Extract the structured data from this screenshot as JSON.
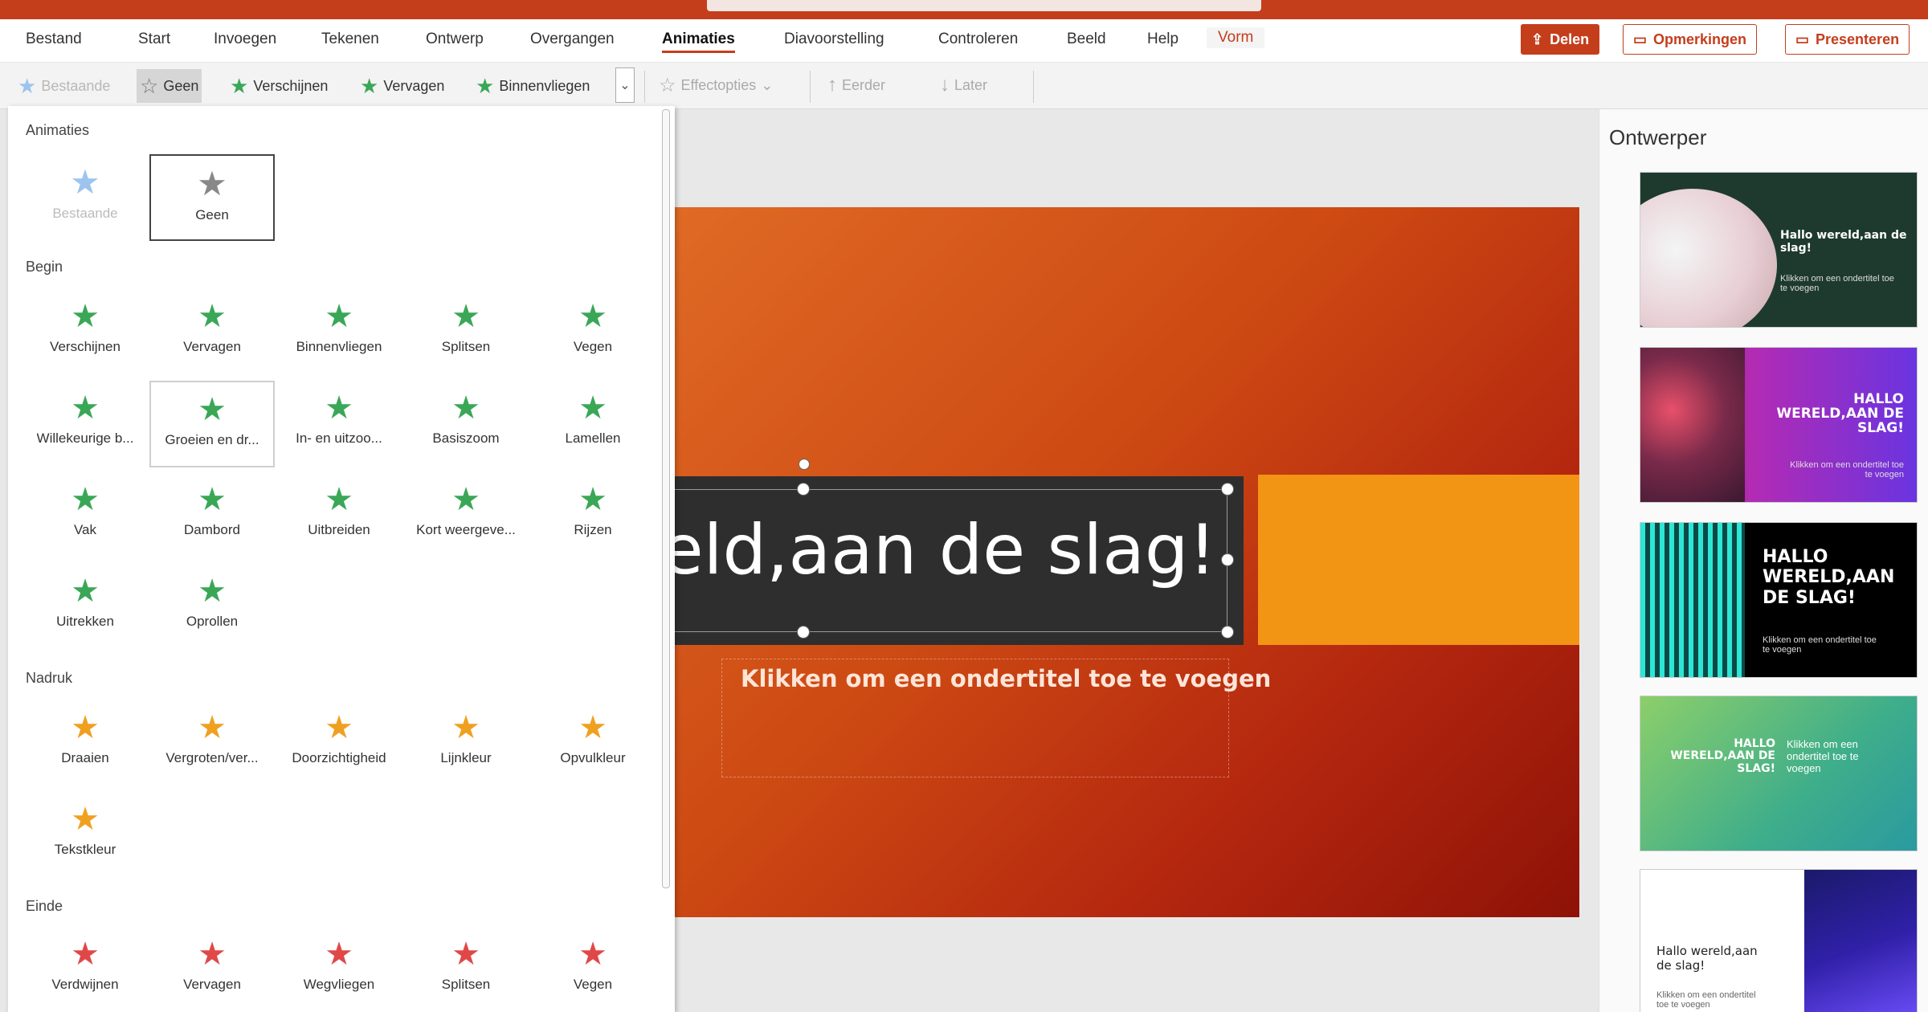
{
  "menu": [
    "Bestand",
    "Start",
    "Invoegen",
    "Tekenen",
    "Ontwerp",
    "Overgangen",
    "Animaties",
    "Diavoorstelling",
    "Controleren",
    "Beeld",
    "Help",
    "Vorm"
  ],
  "header": {
    "share": "Delen",
    "comments": "Opmerkingen",
    "present": "Presenteren"
  },
  "ribbon": {
    "gallery": [
      {
        "label": "Bestaande",
        "state": "disabled"
      },
      {
        "label": "Geen",
        "state": "selected"
      },
      {
        "label": "Verschijnen"
      },
      {
        "label": "Vervagen"
      },
      {
        "label": "Binnenvliegen"
      }
    ],
    "effect_options": "Effectopties",
    "earlier": "Eerder",
    "later": "Later"
  },
  "panel": {
    "sections": {
      "animaties": "Animaties",
      "begin": "Begin",
      "nadruk": "Nadruk",
      "einde": "Einde"
    },
    "animaties": [
      {
        "label": "Bestaande",
        "state": "disabled"
      },
      {
        "label": "Geen",
        "state": "selected"
      }
    ],
    "begin": [
      {
        "label": "Verschijnen"
      },
      {
        "label": "Vervagen"
      },
      {
        "label": "Binnenvliegen"
      },
      {
        "label": "Splitsen"
      },
      {
        "label": "Vegen"
      },
      {
        "label": "Willekeurige b..."
      },
      {
        "label": "Groeien en dr...",
        "state": "hover"
      },
      {
        "label": "In- en uitzoo..."
      },
      {
        "label": "Basiszoom"
      },
      {
        "label": "Lamellen"
      },
      {
        "label": "Vak"
      },
      {
        "label": "Dambord"
      },
      {
        "label": "Uitbreiden"
      },
      {
        "label": "Kort weergeve..."
      },
      {
        "label": "Rijzen"
      },
      {
        "label": "Uitrekken"
      },
      {
        "label": "Oprollen"
      }
    ],
    "nadruk": [
      {
        "label": "Draaien"
      },
      {
        "label": "Vergroten/ver..."
      },
      {
        "label": "Doorzichtigheid"
      },
      {
        "label": "Lijnkleur"
      },
      {
        "label": "Opvulkleur"
      },
      {
        "label": "Tekstkleur"
      }
    ],
    "einde": [
      {
        "label": "Verdwijnen"
      },
      {
        "label": "Vervagen"
      },
      {
        "label": "Wegvliegen"
      },
      {
        "label": "Splitsen"
      },
      {
        "label": "Vegen"
      }
    ]
  },
  "slide": {
    "title": "ereld,aan de slag!",
    "subtitle": "Klikken om een ondertitel toe te voegen"
  },
  "designer": {
    "title": "Ontwerper",
    "thumbs": [
      {
        "title": "Hallo wereld,aan de slag!",
        "sub": "Klikken om een ondertitel toe te voegen"
      },
      {
        "title": "HALLO WERELD,AAN DE SLAG!",
        "sub": "Klikken om een ondertitel toe te voegen"
      },
      {
        "title": "HALLO WERELD,AAN DE SLAG!",
        "sub": "Klikken om een ondertitel toe te voegen"
      },
      {
        "title": "HALLO WERELD,AAN DE SLAG!",
        "sub": "Klikken om een ondertitel toe te voegen"
      },
      {
        "title": "Hallo wereld,aan de slag!",
        "sub": "Klikken om een ondertitel toe te voegen"
      }
    ]
  },
  "colors": {
    "accent": "#c43e1c",
    "entrance": "#3aa757",
    "emphasis": "#f0a020",
    "exit": "#e04848"
  }
}
